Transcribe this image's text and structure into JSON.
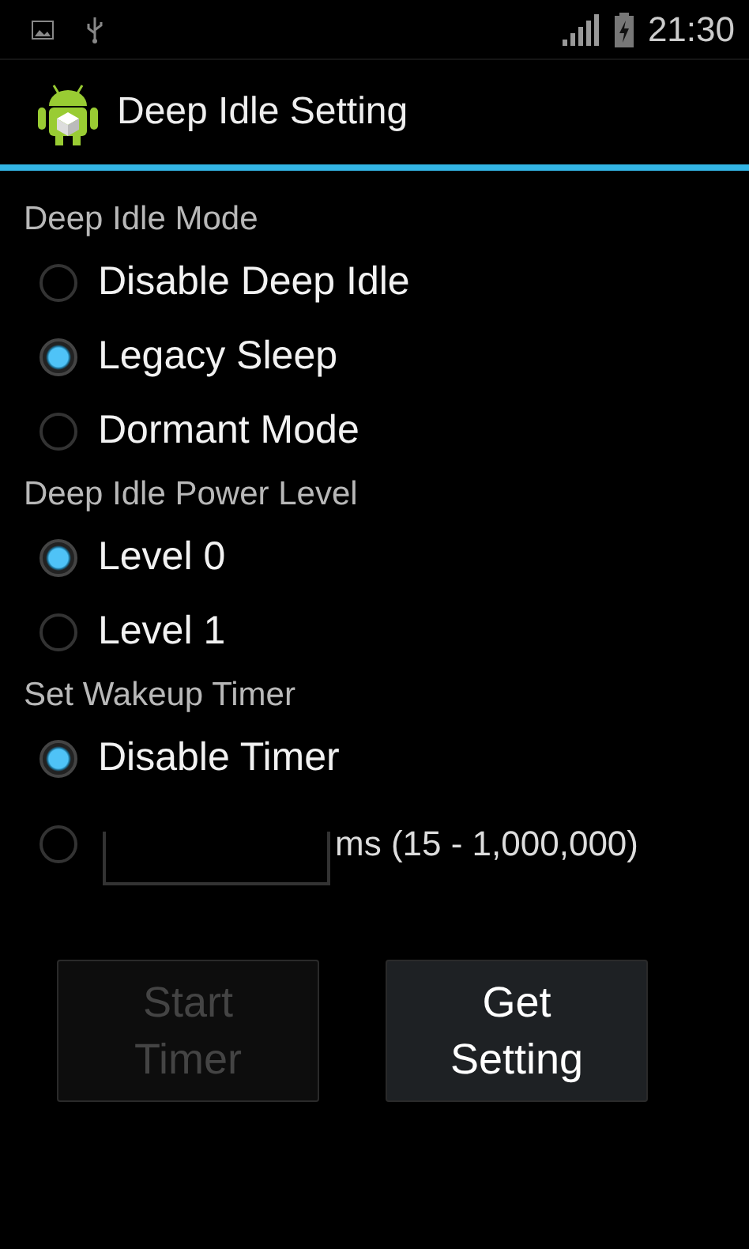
{
  "status_bar": {
    "time": "21:30"
  },
  "action_bar": {
    "title": "Deep Idle Setting"
  },
  "groups": [
    {
      "title": "Deep Idle Mode",
      "options": [
        {
          "kind": "text",
          "label": "Disable Deep Idle",
          "selected": false
        },
        {
          "kind": "text",
          "label": "Legacy Sleep",
          "selected": true
        },
        {
          "kind": "text",
          "label": "Dormant Mode",
          "selected": false
        }
      ]
    },
    {
      "title": "Deep Idle Power Level",
      "options": [
        {
          "kind": "text",
          "label": "Level 0",
          "selected": true
        },
        {
          "kind": "text",
          "label": "Level 1",
          "selected": false
        }
      ]
    },
    {
      "title": "Set Wakeup Timer",
      "options": [
        {
          "kind": "text",
          "label": "Disable Timer",
          "selected": true
        },
        {
          "kind": "input",
          "suffix": "ms (15 - 1,000,000)",
          "selected": false
        }
      ]
    }
  ],
  "buttons": [
    {
      "label": "Start Timer",
      "disabled": true
    },
    {
      "label": "Get Setting",
      "disabled": false
    }
  ]
}
